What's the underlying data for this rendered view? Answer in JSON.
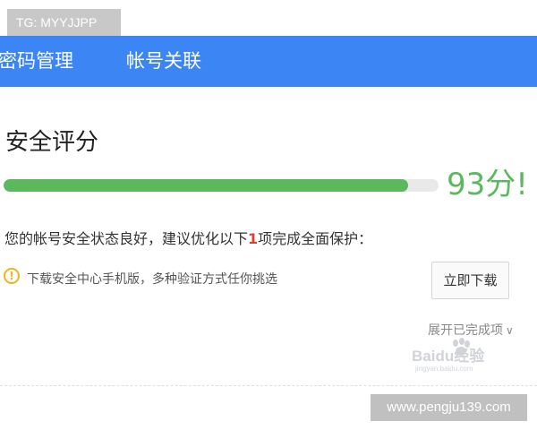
{
  "watermarks": {
    "top_left": "TG: MYYJJPP",
    "bottom_right": "www.pengju139.com",
    "baidu_logo": "Baidu经验",
    "baidu_url": "jingyan.baidu.com"
  },
  "tabs": [
    {
      "label": "密码管理"
    },
    {
      "label": "帐号关联"
    }
  ],
  "security": {
    "title": "安全评分",
    "score_text": "93分!",
    "progress_fraction": 0.93,
    "status_prefix": "您的帐号安全状态良好，建议优化以下",
    "status_count": "1",
    "status_suffix": "项完成全面保护："
  },
  "download": {
    "text": "下载安全中心手机版，多种验证方式任你挑选",
    "button_label": "立即下载"
  },
  "expand": {
    "label": "展开已完成项"
  },
  "colors": {
    "tab_bar": "#3b85f5",
    "progress": "#5cb85c",
    "score": "#5cb85c",
    "highlight_number": "#e03c31",
    "warning": "#f2b21d"
  },
  "icons": {
    "warning": "exclamation-circle-icon",
    "expand": "chevron-down-icon",
    "baidu": "paw-icon"
  }
}
